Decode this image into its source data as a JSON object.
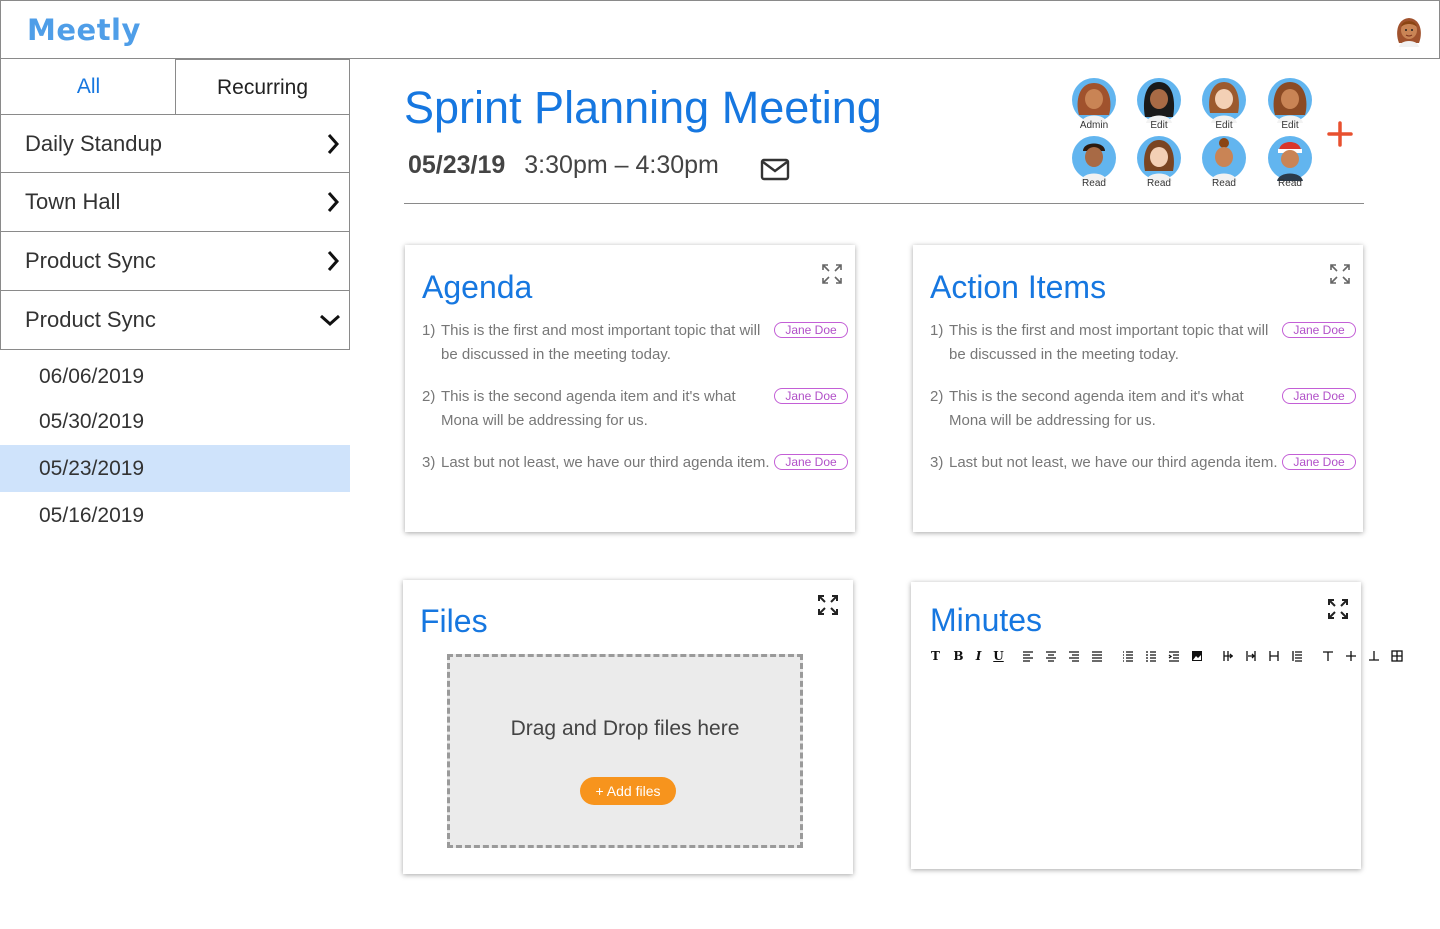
{
  "app": {
    "logo": "Meetly"
  },
  "sidebar": {
    "tabs": [
      {
        "label": "All"
      },
      {
        "label": "Recurring"
      }
    ],
    "meetings": [
      {
        "label": "Daily Standup",
        "state": "collapsed"
      },
      {
        "label": "Town Hall",
        "state": "collapsed"
      },
      {
        "label": "Product Sync",
        "state": "collapsed"
      },
      {
        "label": "Product Sync",
        "state": "expanded"
      }
    ],
    "dates": [
      "06/06/2019",
      "05/30/2019",
      "05/23/2019",
      "05/16/2019"
    ],
    "selected_date": "05/23/2019"
  },
  "meeting": {
    "title": "Sprint Planning Meeting",
    "date": "05/23/19",
    "time": "3:30pm – 4:30pm"
  },
  "participants": [
    {
      "role": "Admin"
    },
    {
      "role": "Edit"
    },
    {
      "role": "Edit"
    },
    {
      "role": "Edit"
    },
    {
      "role": "Read"
    },
    {
      "role": "Read"
    },
    {
      "role": "Read"
    },
    {
      "role": "Read"
    }
  ],
  "agenda": {
    "title": "Agenda",
    "items": [
      {
        "num": "1)",
        "text": "This is the first and most important topic that will be discussed in the meeting today.",
        "assignee": "Jane Doe"
      },
      {
        "num": "2)",
        "text": "This is the second agenda item and it's what Mona will be addressing for us.",
        "assignee": "Jane Doe"
      },
      {
        "num": "3)",
        "text": "Last but not least, we have our third agenda item.",
        "assignee": "Jane Doe"
      }
    ]
  },
  "action_items": {
    "title": "Action Items",
    "items": [
      {
        "num": "1)",
        "text": "This is the first and most important topic that will be discussed in the meeting today.",
        "assignee": "Jane Doe"
      },
      {
        "num": "2)",
        "text": "This is the second agenda item and it's what Mona will be addressing for us.",
        "assignee": "Jane Doe"
      },
      {
        "num": "3)",
        "text": "Last but not least, we have our third agenda item.",
        "assignee": "Jane Doe"
      }
    ]
  },
  "files": {
    "title": "Files",
    "drop_text": "Drag and Drop files here",
    "add_button": "+ Add files"
  },
  "minutes": {
    "title": "Minutes",
    "toolbar_text": {
      "text_style": "T",
      "bold": "B",
      "italic": "I",
      "underline": "U"
    }
  },
  "colors": {
    "accent": "#1677e0",
    "logo": "#4f9ee8",
    "add": "#f7941d",
    "tag": "#c35fd6",
    "selected": "#cfe3fb",
    "plus": "#e8502f"
  },
  "icons": [
    "user-avatar",
    "chevron-right-icon",
    "chevron-down-icon",
    "mail-icon",
    "plus-icon",
    "expand-icon"
  ]
}
